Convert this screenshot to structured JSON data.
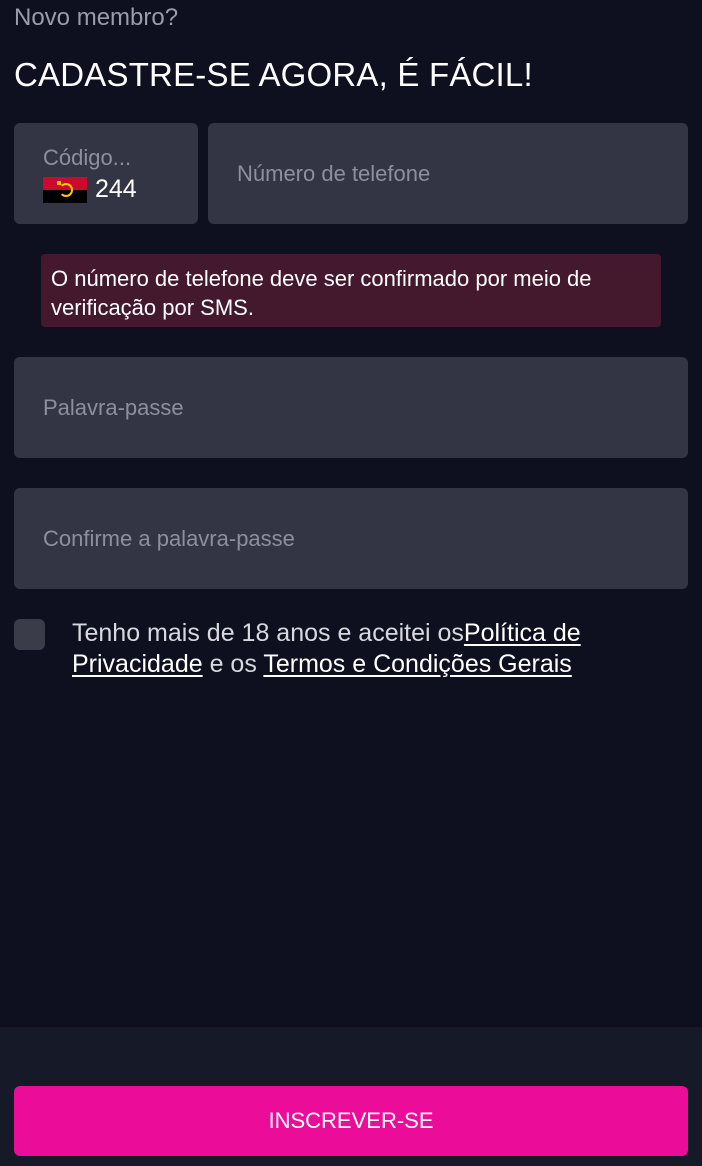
{
  "header": {
    "subtitle": "Novo membro?",
    "title": "CADASTRE-SE AGORA, É FÁCIL!"
  },
  "phone": {
    "code_label": "Código...",
    "code_flag_icon": "angola-flag-icon",
    "code_value": "244",
    "number_placeholder": "Número de telefone",
    "number_value": ""
  },
  "notice": {
    "text": "O número de telefone deve ser confirmado por meio de verificação por SMS."
  },
  "password": {
    "placeholder": "Palavra-passe",
    "value": ""
  },
  "confirm_password": {
    "placeholder": "Confirme a palavra-passe",
    "value": ""
  },
  "terms": {
    "checked": false,
    "text_prefix": "Tenho mais de 18 anos e aceitei os",
    "privacy_link": "Política de Privacidade",
    "text_middle": " e os ",
    "terms_link": "Termos e Condições Gerais"
  },
  "submit": {
    "label": "INSCREVER-SE"
  },
  "colors": {
    "background": "#0e1020",
    "field": "#333544",
    "notice_bg": "#45192d",
    "accent": "#ec0c9a"
  }
}
